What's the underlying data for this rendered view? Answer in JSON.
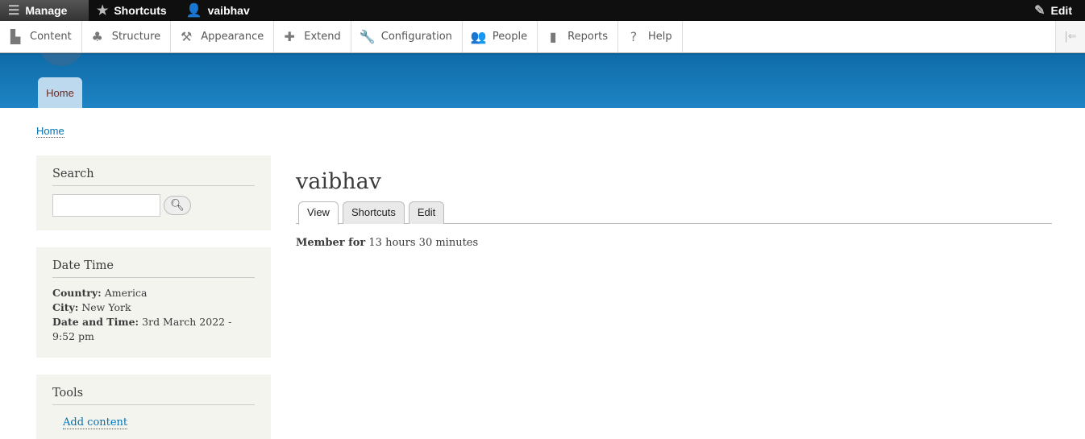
{
  "toolbar": {
    "manage": "Manage",
    "shortcuts": "Shortcuts",
    "user": "vaibhav",
    "edit": "Edit"
  },
  "tray": [
    {
      "label": "Content",
      "icon": "▙"
    },
    {
      "label": "Structure",
      "icon": "♣"
    },
    {
      "label": "Appearance",
      "icon": "⚒"
    },
    {
      "label": "Extend",
      "icon": "✚"
    },
    {
      "label": "Configuration",
      "icon": "🔧"
    },
    {
      "label": "People",
      "icon": "👥"
    },
    {
      "label": "Reports",
      "icon": "▮"
    },
    {
      "label": "Help",
      "icon": "?"
    }
  ],
  "nav": {
    "home": "Home"
  },
  "breadcrumb": "Home",
  "search": {
    "title": "Search",
    "value": ""
  },
  "datetime": {
    "title": "Date Time",
    "country_label": "Country:",
    "country": "America",
    "city_label": "City:",
    "city": "New York",
    "dt_label": "Date and Time:",
    "dt": "3rd March 2022 - 9:52 pm"
  },
  "tools": {
    "title": "Tools",
    "add_content": "Add content"
  },
  "main": {
    "title": "vaibhav",
    "tabs": [
      "View",
      "Shortcuts",
      "Edit"
    ],
    "member_label": "Member for",
    "member_value": "13 hours 30 minutes"
  }
}
